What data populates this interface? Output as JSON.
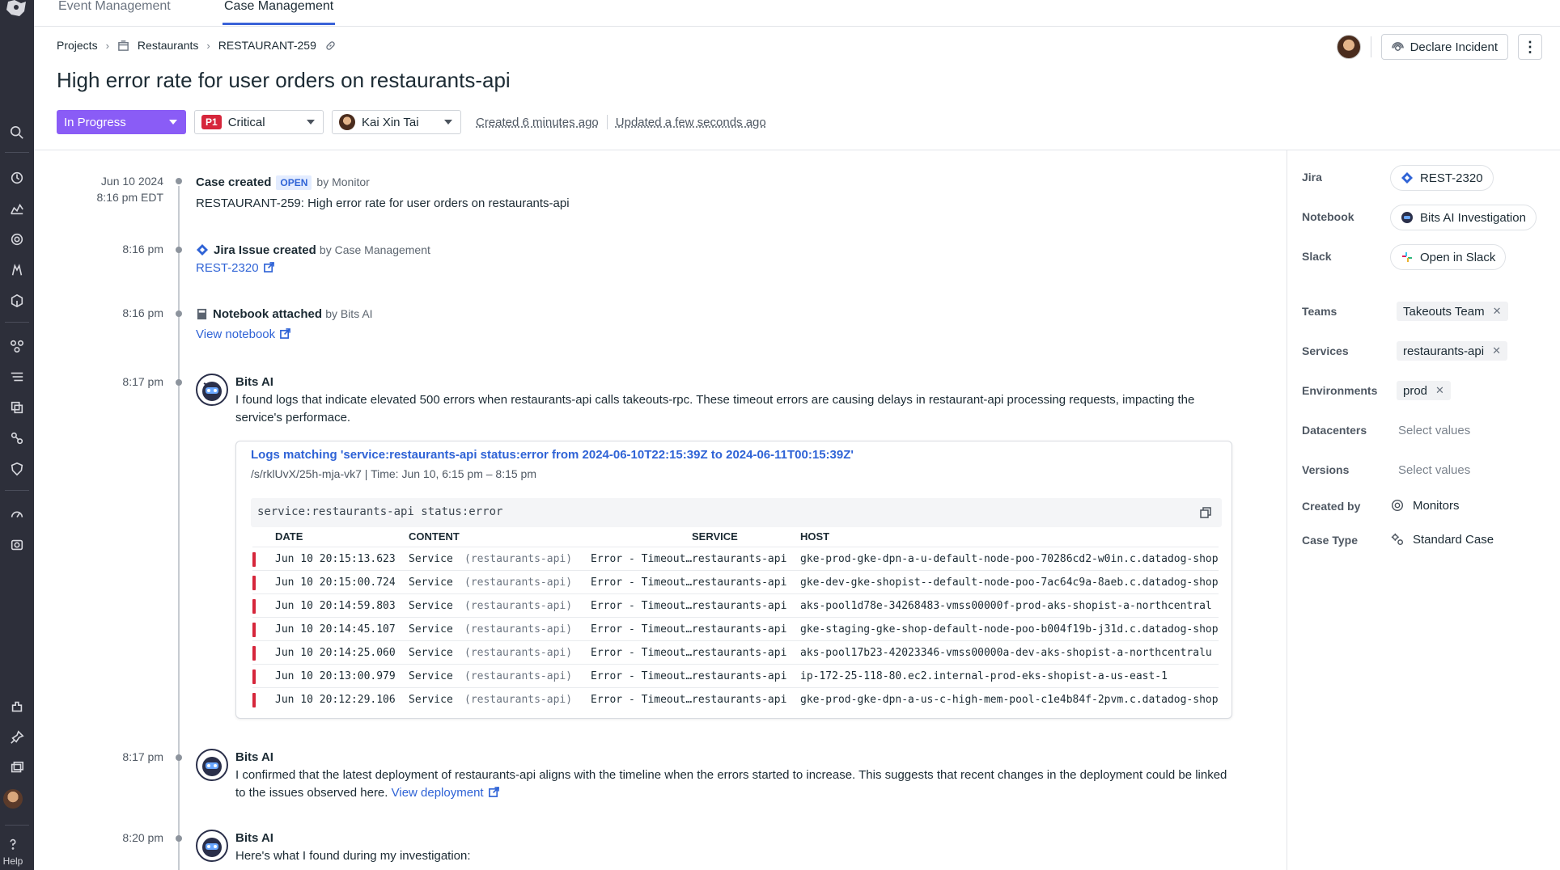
{
  "tabs": [
    {
      "label": "Event Management",
      "active": false
    },
    {
      "label": "Case Management",
      "active": true
    }
  ],
  "breadcrumb": {
    "projects": "Projects",
    "restaurants": "Restaurants",
    "case_id": "RESTAURANT-259"
  },
  "title": "High error rate for user orders on restaurants-api",
  "header": {
    "declare_incident": "Declare Incident"
  },
  "status": {
    "state": "In Progress",
    "priority_badge": "P1",
    "priority": "Critical",
    "assignee": "Kai Xin Tai",
    "created": "Created 6 minutes ago",
    "updated": "Updated a few seconds ago"
  },
  "timeline": {
    "e1": {
      "date": "Jun 10 2024",
      "time": "8:16 pm EDT",
      "title": "Case created",
      "badge": "OPEN",
      "by": "by Monitor",
      "body": "RESTAURANT-259: High error rate for user orders on restaurants-api"
    },
    "e2": {
      "time": "8:16 pm",
      "title": "Jira Issue created",
      "by": "by Case Management",
      "link": "REST-2320"
    },
    "e3": {
      "time": "8:16 pm",
      "title": "Notebook attached",
      "by": "by Bits AI",
      "link": "View notebook"
    },
    "e4": {
      "time": "8:17 pm",
      "author": "Bits AI",
      "body": "I found logs that indicate elevated 500 errors when restaurants-api calls takeouts-rpc. These timeout errors are causing delays in restaurant-api processing requests, impacting the service's performace."
    },
    "e5": {
      "time": "8:17 pm",
      "author": "Bits AI",
      "body": "I confirmed that the latest deployment of restaurants-api aligns with the timeline when the errors started to increase. This suggests that recent changes in the deployment could be linked to the issues observed here.",
      "link": "View deployment"
    },
    "e6": {
      "time": "8:20 pm",
      "author": "Bits AI",
      "body": "Here's what I found during my investigation:"
    }
  },
  "logs": {
    "title": "Logs matching 'service:restaurants-api status:error from 2024-06-10T22:15:39Z to 2024-06-11T00:15:39Z'",
    "subtitle": "/s/rklUvX/25h-mja-vk7  |  Time: Jun 10, 6:15 pm – 8:15 pm",
    "query": "service:restaurants-api status:error",
    "columns": {
      "date": "DATE",
      "content": "CONTENT",
      "service": "SERVICE",
      "host": "HOST"
    },
    "rows": [
      {
        "date": "Jun 10 20:15:13.623",
        "c1": "Service",
        "c2": "(restaurants-api)",
        "c3": "Error - Timeout…",
        "service": "restaurants-api",
        "host": "gke-prod-gke-dpn-a-u-default-node-poo-70286cd2-w0in.c.datadog-shop"
      },
      {
        "date": "Jun 10 20:15:00.724",
        "c1": "Service",
        "c2": "(restaurants-api)",
        "c3": "Error - Timeout…",
        "service": "restaurants-api",
        "host": "gke-dev-gke-shopist--default-node-poo-7ac64c9a-8aeb.c.datadog-shop"
      },
      {
        "date": "Jun 10 20:14:59.803",
        "c1": "Service",
        "c2": "(restaurants-api)",
        "c3": "Error - Timeout…",
        "service": "restaurants-api",
        "host": "aks-pool1d78e-34268483-vmss00000f-prod-aks-shopist-a-northcentral"
      },
      {
        "date": "Jun 10 20:14:45.107",
        "c1": "Service",
        "c2": "(restaurants-api)",
        "c3": "Error - Timeout…",
        "service": "restaurants-api",
        "host": "gke-staging-gke-shop-default-node-poo-b004f19b-j31d.c.datadog-shop"
      },
      {
        "date": "Jun 10 20:14:25.060",
        "c1": "Service",
        "c2": "(restaurants-api)",
        "c3": "Error - Timeout…",
        "service": "restaurants-api",
        "host": "aks-pool17b23-42023346-vmss00000a-dev-aks-shopist-a-northcentralu"
      },
      {
        "date": "Jun 10 20:13:00.979",
        "c1": "Service",
        "c2": "(restaurants-api)",
        "c3": "Error - Timeout…",
        "service": "restaurants-api",
        "host": "ip-172-25-118-80.ec2.internal-prod-eks-shopist-a-us-east-1"
      },
      {
        "date": "Jun 10 20:12:29.106",
        "c1": "Service",
        "c2": "(restaurants-api)",
        "c3": "Error - Timeout…",
        "service": "restaurants-api",
        "host": "gke-prod-gke-dpn-a-us-c-high-mem-pool-c1e4b84f-2pvm.c.datadog-shop"
      }
    ]
  },
  "panel": {
    "jira": {
      "label": "Jira",
      "value": "REST-2320"
    },
    "notebook": {
      "label": "Notebook",
      "value": "Bits AI Investigation"
    },
    "slack": {
      "label": "Slack",
      "value": "Open in Slack"
    },
    "teams": {
      "label": "Teams",
      "value": "Takeouts Team"
    },
    "services": {
      "label": "Services",
      "value": "restaurants-api"
    },
    "environments": {
      "label": "Environments",
      "value": "prod"
    },
    "datacenters": {
      "label": "Datacenters",
      "placeholder": "Select values"
    },
    "versions": {
      "label": "Versions",
      "placeholder": "Select values"
    },
    "created_by": {
      "label": "Created by",
      "value": "Monitors"
    },
    "case_type": {
      "label": "Case Type",
      "value": "Standard Case"
    }
  },
  "nav": {
    "help": "Help"
  },
  "colors": {
    "accent": "#8a5cf6",
    "link": "#2f63d6",
    "critical": "#d6263b",
    "nav_bg": "#2d2f3a"
  }
}
